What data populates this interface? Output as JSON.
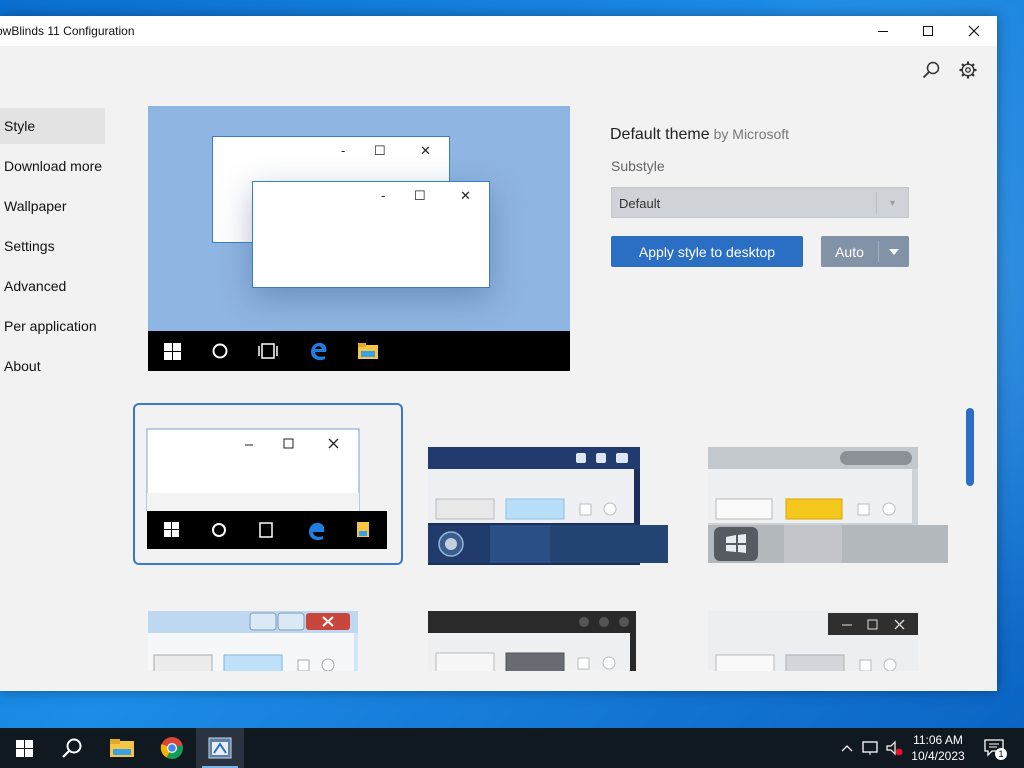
{
  "window": {
    "title": "owBlinds 11 Configuration"
  },
  "titlebar": {
    "minimize": "–",
    "maximize": "☐",
    "close": "✕"
  },
  "toolbar": {
    "search_icon": "search-icon",
    "settings_icon": "gear-icon"
  },
  "sidebar": {
    "items": [
      {
        "label": "Style",
        "selected": true
      },
      {
        "label": "Download more"
      },
      {
        "label": "Wallpaper"
      },
      {
        "label": "Settings"
      },
      {
        "label": "Advanced"
      },
      {
        "label": "Per application"
      },
      {
        "label": "About"
      }
    ]
  },
  "preview": {
    "caption_min": "-",
    "caption_max": "☐",
    "caption_close": "✕"
  },
  "details": {
    "theme_name": "Default theme",
    "theme_author": "by Microsoft",
    "substyle_label": "Substyle",
    "substyle_value": "Default",
    "apply_label": "Apply style to desktop",
    "auto_label": "Auto"
  },
  "gallery": {
    "tiles": [
      {
        "style": "windows-10-default",
        "selected": true
      },
      {
        "style": "dark-navy-glass"
      },
      {
        "style": "silver-xp-style"
      },
      {
        "style": "windows-7-aero"
      },
      {
        "style": "dark-glossy"
      },
      {
        "style": "light-frost"
      }
    ]
  },
  "taskbar": {
    "start_icon": "windows-start-icon",
    "apps": [
      "search-icon",
      "file-explorer-icon",
      "chrome-icon",
      "windowblinds-icon"
    ],
    "time": "11:06 AM",
    "date": "10/4/2023",
    "notification_count": "1"
  },
  "colors": {
    "accent": "#2b6fc4",
    "window_bg": "#f2f2f2",
    "taskbar": "#101820",
    "preview_bg": "#8fb5e2"
  }
}
